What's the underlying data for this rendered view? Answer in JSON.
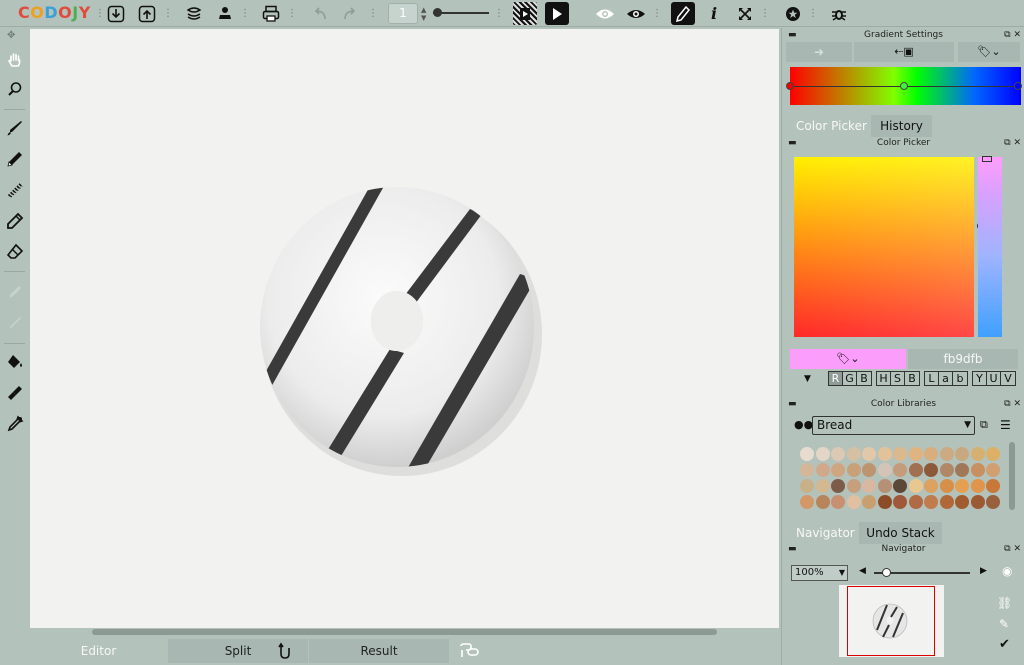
{
  "app": {
    "logo_letters": [
      "C",
      "O",
      "D",
      "O",
      "J",
      "Y"
    ]
  },
  "toolbar": {
    "frame_number": "1"
  },
  "bottom_tabs": {
    "editor": "Editor",
    "split": "Split",
    "result": "Result"
  },
  "gradient_panel": {
    "title": "Gradient Settings",
    "stops": [
      "#ff0000",
      "#00ff00",
      "#0000ff"
    ]
  },
  "color_tabs": {
    "picker": "Color Picker",
    "history": "History"
  },
  "color_picker": {
    "title": "Color Picker",
    "hex_value": "fb9dfb",
    "current_color": "#fb9dfb",
    "modes": [
      "R",
      "G",
      "B",
      "H",
      "S",
      "B",
      "L",
      "a",
      "b",
      "Y",
      "U",
      "V"
    ],
    "active_mode": "R"
  },
  "color_libraries": {
    "title": "Color Libraries",
    "selected": "Bread",
    "swatches": [
      "#e8dcd0",
      "#e4d6c6",
      "#dbc9b3",
      "#d6c0a4",
      "#e0c8a8",
      "#e2c29a",
      "#dcb88e",
      "#e0b480",
      "#d8ae7e",
      "#ccaa82",
      "#c8a880",
      "#d6b070",
      "#dcb066",
      "#d4b698",
      "#cfa98a",
      "#d0a680",
      "#c8a07a",
      "#bc9470",
      "#d4c4b8",
      "#c49c7c",
      "#a07050",
      "#8c5a3a",
      "#b08868",
      "#a07858",
      "#c89060",
      "#d0a070",
      "#c8b088",
      "#d4b890",
      "#7c5c48",
      "#c6a07e",
      "#d8b8a0",
      "#b69074",
      "#5c4838",
      "#e8c890",
      "#dca060",
      "#d89048",
      "#e4a050",
      "#e0944c",
      "#c87838",
      "#d49868",
      "#b8845c",
      "#c89070",
      "#e0c0a0",
      "#c8a070",
      "#8c4c28",
      "#a0583a",
      "#b06a44",
      "#c07c4c",
      "#b06838",
      "#a05c30",
      "#9c5a34",
      "#98603c"
    ]
  },
  "nav_tabs": {
    "navigator": "Navigator",
    "undo_stack": "Undo Stack"
  },
  "navigator": {
    "title": "Navigator",
    "zoom": "100%"
  }
}
